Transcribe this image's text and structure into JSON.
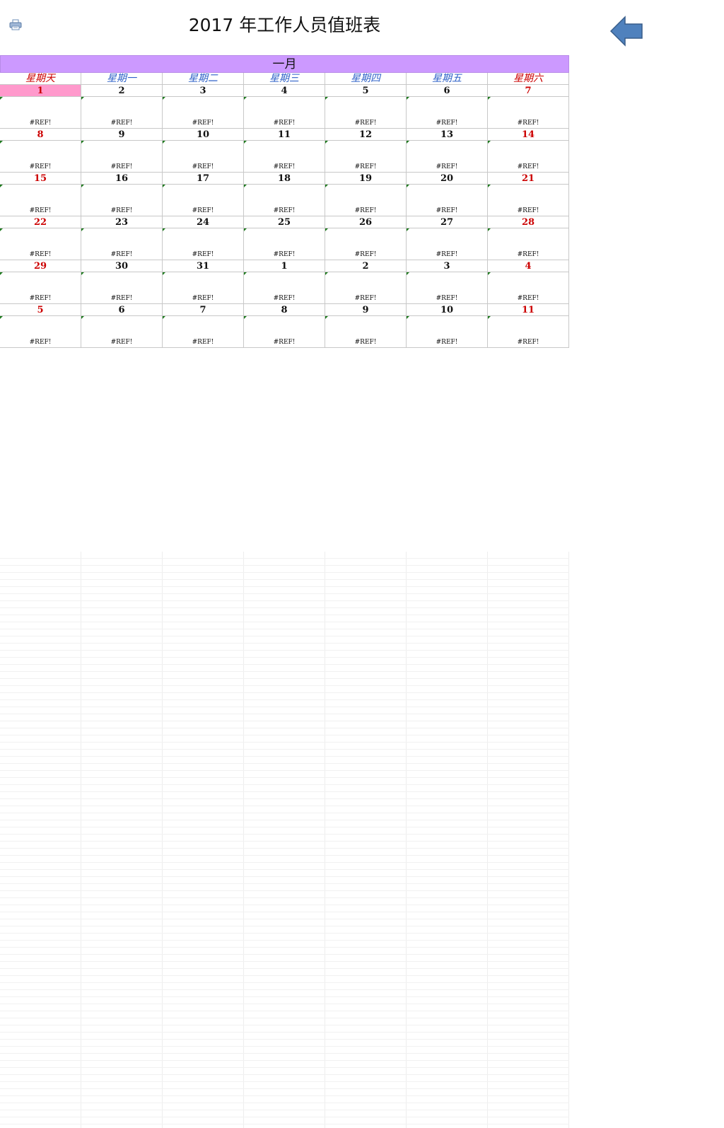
{
  "title": "2017 年工作人员值班表",
  "icons": {
    "print": "printer-icon",
    "back": "back-arrow-icon"
  },
  "colors": {
    "month_header_bg": "#cc99ff",
    "weekday_blue": "#2f62c8",
    "weekend_red": "#cc0000",
    "today_highlight": "#ff99cc",
    "arrow_fill": "#4f81bd"
  },
  "calendar": {
    "month": "一月",
    "weekdays": [
      "星期天",
      "星期一",
      "星期二",
      "星期三",
      "星期四",
      "星期五",
      "星期六"
    ],
    "weeks": [
      {
        "dates": [
          "1",
          "2",
          "3",
          "4",
          "5",
          "6",
          "7"
        ],
        "duty": [
          "#REF!",
          "#REF!",
          "#REF!",
          "#REF!",
          "#REF!",
          "#REF!",
          "#REF!"
        ]
      },
      {
        "dates": [
          "8",
          "9",
          "10",
          "11",
          "12",
          "13",
          "14"
        ],
        "duty": [
          "#REF!",
          "#REF!",
          "#REF!",
          "#REF!",
          "#REF!",
          "#REF!",
          "#REF!"
        ]
      },
      {
        "dates": [
          "15",
          "16",
          "17",
          "18",
          "19",
          "20",
          "21"
        ],
        "duty": [
          "#REF!",
          "#REF!",
          "#REF!",
          "#REF!",
          "#REF!",
          "#REF!",
          "#REF!"
        ]
      },
      {
        "dates": [
          "22",
          "23",
          "24",
          "25",
          "26",
          "27",
          "28"
        ],
        "duty": [
          "#REF!",
          "#REF!",
          "#REF!",
          "#REF!",
          "#REF!",
          "#REF!",
          "#REF!"
        ]
      },
      {
        "dates": [
          "29",
          "30",
          "31",
          "1",
          "2",
          "3",
          "4"
        ],
        "duty": [
          "#REF!",
          "#REF!",
          "#REF!",
          "#REF!",
          "#REF!",
          "#REF!",
          "#REF!"
        ]
      },
      {
        "dates": [
          "5",
          "6",
          "7",
          "8",
          "9",
          "10",
          "11"
        ],
        "duty": [
          "#REF!",
          "#REF!",
          "#REF!",
          "#REF!",
          "#REF!",
          "#REF!",
          "#REF!"
        ]
      }
    ]
  }
}
